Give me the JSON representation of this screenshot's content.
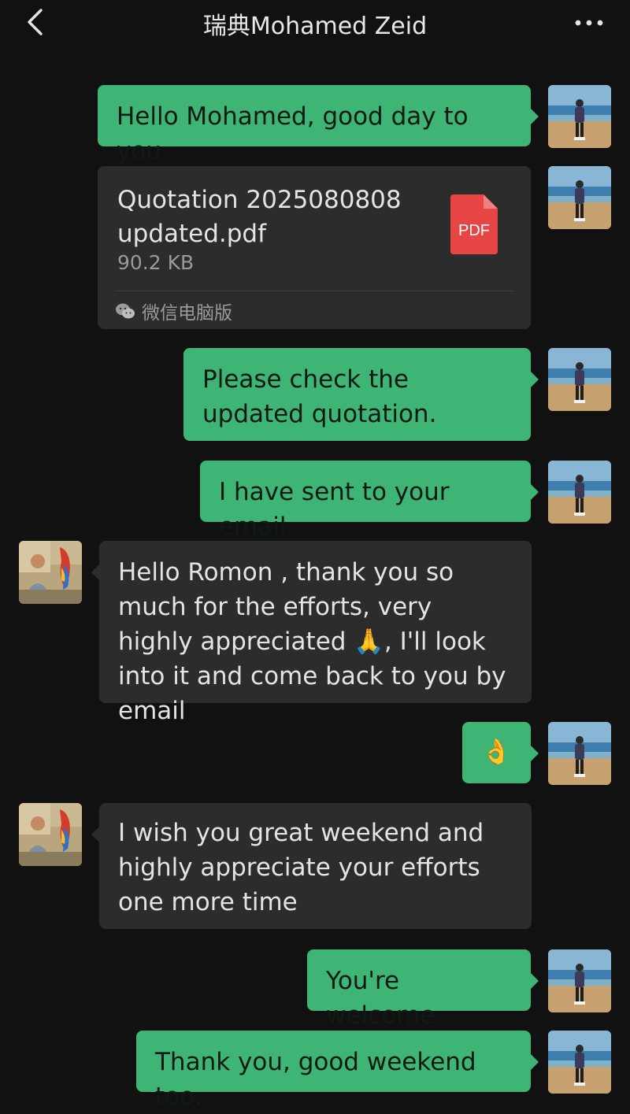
{
  "header": {
    "title": "瑞典Mohamed Zeid",
    "back_icon": "chevron-left-icon",
    "more_icon": "more-dots-icon"
  },
  "colors": {
    "background": "#111111",
    "sent_bubble": "#3eb575",
    "received_bubble": "#2c2c2c",
    "pdf_red": "#e84545"
  },
  "messages": [
    {
      "sender": "me",
      "type": "text",
      "text": "Hello Mohamed, good day to you."
    },
    {
      "sender": "me",
      "type": "file",
      "file": {
        "name": "Quotation 2025080808 updated.pdf",
        "size": "90.2 KB",
        "badge": "PDF",
        "source": "微信电脑版",
        "source_icon": "wechat-icon"
      }
    },
    {
      "sender": "me",
      "type": "text",
      "text": "Please check the updated quotation."
    },
    {
      "sender": "me",
      "type": "text",
      "text": "I have sent to your email."
    },
    {
      "sender": "them",
      "type": "text",
      "text_before": "Hello Romon , thank you so much for the efforts, very highly appreciated",
      "emoji": "🙏",
      "text_after": ", I'll look into it and come back to you by email"
    },
    {
      "sender": "me",
      "type": "emoji",
      "emoji": "👌"
    },
    {
      "sender": "them",
      "type": "text",
      "text": "I wish you great weekend and highly appreciate your efforts one more time"
    },
    {
      "sender": "me",
      "type": "text",
      "text": "You're welcome"
    },
    {
      "sender": "me",
      "type": "text",
      "text": "Thank you, good weekend too."
    }
  ]
}
